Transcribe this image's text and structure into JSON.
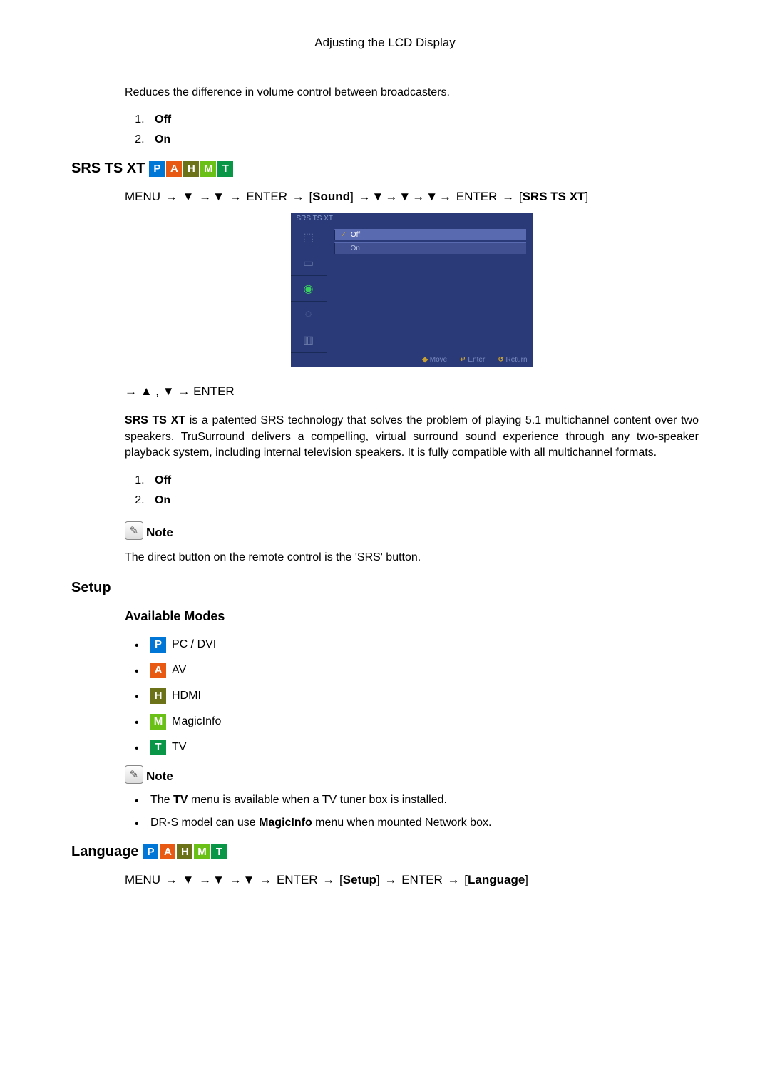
{
  "header": {
    "title": "Adjusting the LCD Display"
  },
  "intro": {
    "text": "Reduces the difference in volume control between broadcasters."
  },
  "list_off_on_1": {
    "item1": "Off",
    "item2": "On"
  },
  "srs": {
    "title": "SRS TS XT",
    "badges": {
      "p": "P",
      "a": "A",
      "h": "H",
      "m": "M",
      "t": "T"
    },
    "nav": {
      "menu": "MENU",
      "arrow": "→",
      "down": "▼",
      "enter": "ENTER",
      "sound": "Sound",
      "srs": "SRS TS XT"
    },
    "osd": {
      "title": "SRS TS XT",
      "off": "Off",
      "on": "On",
      "foot_move": "Move",
      "foot_enter": "Enter",
      "foot_return": "Return"
    },
    "nav_after": {
      "up": "▲",
      "down": "▼",
      "arrow": "→",
      "comma": ",",
      "enter": "ENTER"
    },
    "desc_strong": "SRS TS XT",
    "desc_rest": " is a patented SRS technology that solves the problem of playing 5.1 multichannel content over two speakers. TruSurround delivers a compelling, virtual surround sound experience through any two-speaker playback system, including internal television speakers. It is fully compatible with all multichannel formats.",
    "note_label": "Note",
    "note_text": "The direct button on the remote control is the 'SRS' button."
  },
  "list_off_on_2": {
    "item1": "Off",
    "item2": "On"
  },
  "setup": {
    "title": "Setup",
    "sub": "Available Modes",
    "modes": {
      "pc": "PC / DVI",
      "av": "AV",
      "hdmi": "HDMI",
      "magic": "MagicInfo",
      "tv": "TV"
    },
    "note_label": "Note",
    "note1_pre": "The ",
    "note1_b": "TV",
    "note1_post": " menu is available when a TV tuner box is installed.",
    "note2_pre": "DR-S model can use ",
    "note2_b": "MagicInfo",
    "note2_post": " menu when mounted Network box."
  },
  "language": {
    "title": "Language",
    "badges": {
      "p": "P",
      "a": "A",
      "h": "H",
      "m": "M",
      "t": "T"
    },
    "nav": {
      "menu": "MENU",
      "arrow": "→",
      "down": "▼",
      "enter": "ENTER",
      "setup": "Setup",
      "language": "Language"
    }
  }
}
